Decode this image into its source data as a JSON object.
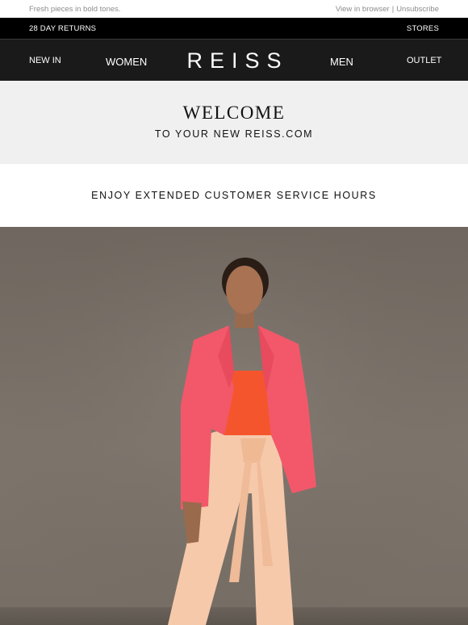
{
  "preheader": {
    "tagline": "Fresh pieces in bold tones.",
    "view_in_browser": "View in browser",
    "divider": "|",
    "unsubscribe": "Unsubscribe"
  },
  "topbar": {
    "returns": "28 DAY RETURNS",
    "stores": "STORES"
  },
  "nav": {
    "new_in": "NEW IN",
    "women": "WOMEN",
    "logo": "REISS",
    "men": "MEN",
    "outlet": "OUTLET"
  },
  "welcome": {
    "title": "WELCOME",
    "subtitle": "TO YOUR NEW REISS.COM"
  },
  "service": {
    "text": "ENJOY EXTENDED CUSTOMER SERVICE HOURS"
  },
  "hero": {
    "background_color": "#766e65",
    "blazer_color": "#f2586a",
    "top_color": "#f5552d",
    "trousers_color": "#f6c9ab"
  }
}
